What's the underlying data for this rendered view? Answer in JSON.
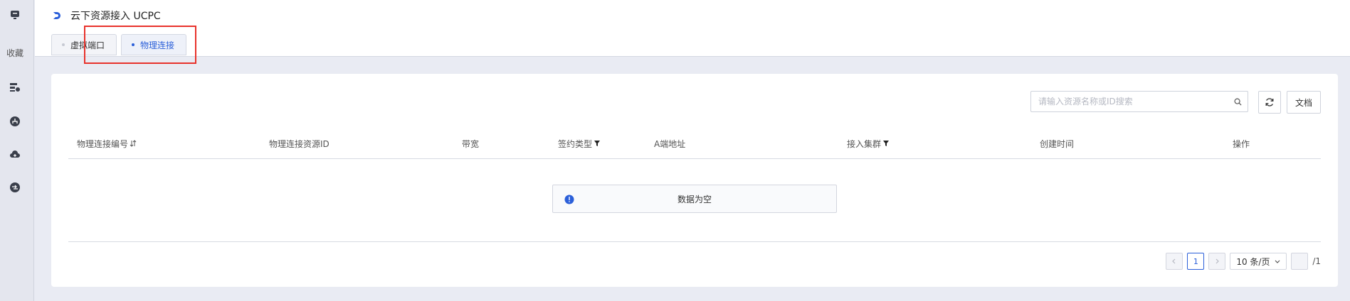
{
  "rail": {
    "favorites_label": "收藏"
  },
  "header": {
    "title": "云下资源接入 UCPC",
    "tabs": [
      {
        "label": "虚拟端口",
        "active": false
      },
      {
        "label": "物理连接",
        "active": true
      }
    ]
  },
  "toolbar": {
    "search_placeholder": "请输入资源名称或ID搜索",
    "doc_label": "文档"
  },
  "table": {
    "columns": [
      "物理连接编号",
      "物理连接资源ID",
      "带宽",
      "签约类型",
      "A端地址",
      "接入集群",
      "创建时间",
      "操作"
    ],
    "empty_text": "数据为空"
  },
  "pagination": {
    "current_page": "1",
    "page_size": "10 条/页",
    "total_pages": "/1"
  },
  "colors": {
    "accent": "#2b5fd9",
    "highlight_border": "#e8322b"
  }
}
